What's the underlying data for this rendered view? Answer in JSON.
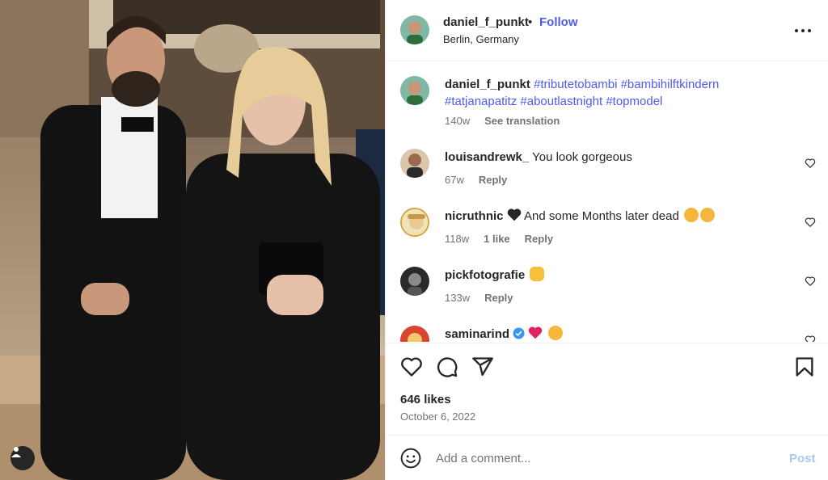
{
  "post": {
    "username": "daniel_f_punkt",
    "separator": "•",
    "follow_label": "Follow",
    "location": "Berlin, Germany",
    "caption": {
      "username": "daniel_f_punkt",
      "hashtags_line1": "#tributetobambi #bambihilftkindern",
      "hashtags_line2": "#tatjanapatitz #aboutlastnight #topmodel",
      "age": "140w",
      "translate_label": "See translation"
    }
  },
  "comments": [
    {
      "username": "louisandrewk_",
      "text": "You look gorgeous",
      "age": "67w",
      "likes": "",
      "reply": "Reply"
    },
    {
      "username": "nicruthnic",
      "text": "And some Months later dead",
      "emoji": "black-heart, sad-faces",
      "age": "118w",
      "likes": "1 like",
      "reply": "Reply"
    },
    {
      "username": "pickfotografie",
      "text": "",
      "emoji": "clapping-hands",
      "age": "133w",
      "likes": "",
      "reply": "Reply"
    },
    {
      "username": "saminarind",
      "text": "",
      "emoji": "verified-badge, red-heart, heart-eyes",
      "age": "",
      "likes": "",
      "reply": ""
    }
  ],
  "actions": {
    "likes": "646 likes",
    "date": "October 6, 2022"
  },
  "add_comment": {
    "placeholder": "Add a comment...",
    "post_label": "Post"
  },
  "colors": {
    "link": "#4e5bed",
    "post_disabled": "#a8c9f7",
    "text": "#262626",
    "muted": "#737373"
  }
}
